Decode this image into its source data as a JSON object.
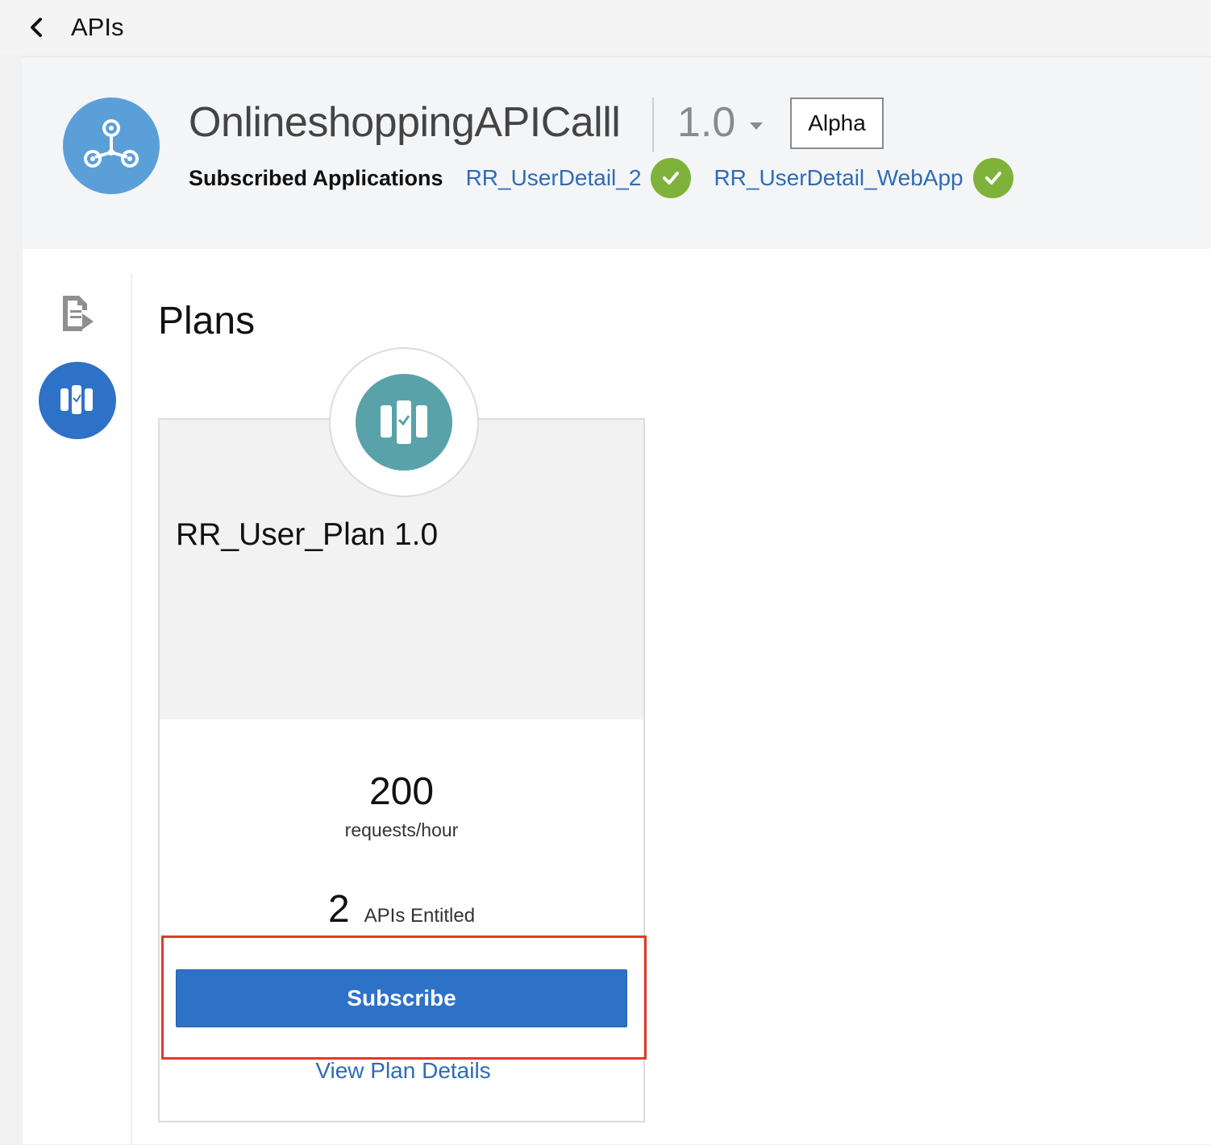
{
  "topbar": {
    "back_icon": "chevron-left-icon",
    "title": "APIs"
  },
  "header": {
    "api_name": "OnlineshoppingAPICalll",
    "version": "1.0",
    "badge": "Alpha",
    "subscribed_label": "Subscribed Applications",
    "subscribed_apps": [
      {
        "name": "RR_UserDetail_2",
        "status_icon": "check-circle-icon"
      },
      {
        "name": "RR_UserDetail_WebApp",
        "status_icon": "check-circle-icon"
      }
    ]
  },
  "nav": {
    "items": [
      {
        "icon": "document-icon",
        "active": false
      },
      {
        "icon": "plans-icon",
        "active": true
      }
    ]
  },
  "plans": {
    "title": "Plans",
    "cards": [
      {
        "name": "RR_User_Plan 1.0",
        "rate_value": "200",
        "rate_unit": "requests/hour",
        "apis_count": "2",
        "apis_label": "APIs Entitled",
        "subscribe_label": "Subscribe",
        "details_label": "View Plan Details"
      }
    ]
  },
  "colors": {
    "accent": "#2e72c7",
    "link": "#2d6cb6",
    "success": "#7fb23a",
    "highlight": "#e0392b",
    "plan_icon": "#5aa2a9"
  }
}
